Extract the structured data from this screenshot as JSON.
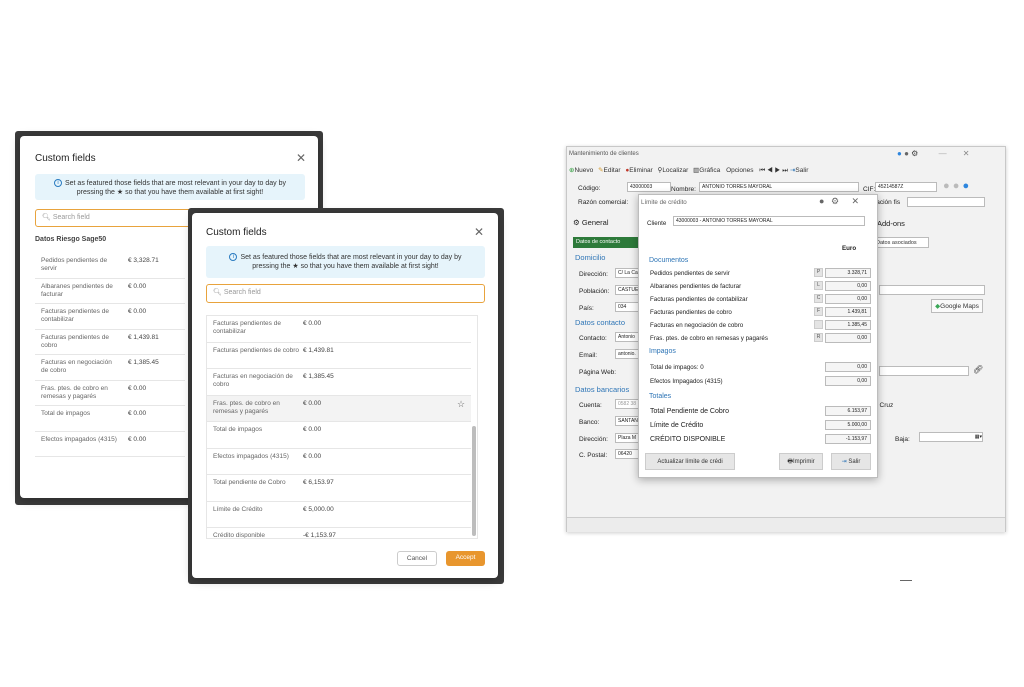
{
  "dialog_back": {
    "title": "Custom fields",
    "info": "Set as featured those fields that are most relevant in your day to day by pressing the ★ so that you have them available at first sight!",
    "search_placeholder": "Search field",
    "section_title": "Datos Riesgo Sage50",
    "rows": [
      {
        "label": "Pedidos pendientes de servir",
        "value": "€ 3,328.71"
      },
      {
        "label": "Albaranes pendientes de facturar",
        "value": "€ 0.00"
      },
      {
        "label": "Facturas pendientes de contabilizar",
        "value": "€ 0.00"
      },
      {
        "label": "Facturas pendientes de cobro",
        "value": "€ 1,439.81"
      },
      {
        "label": "Facturas en negociación de cobro",
        "value": "€ 1,385.45"
      },
      {
        "label": "Fras. ptes. de cobro en remesas y pagarés",
        "value": "€ 0.00"
      },
      {
        "label": "Total de impagos",
        "value": "€ 0.00"
      },
      {
        "label": "Efectos impagados (4315)",
        "value": "€ 0.00"
      }
    ]
  },
  "dialog_front": {
    "title": "Custom fields",
    "info": "Set as featured those fields that are most relevant in your day to day by pressing the ★ so that you have them available at first sight!",
    "search_placeholder": "Search field",
    "rows": [
      {
        "label": "Facturas pendientes de contabilizar",
        "value": "€ 0.00"
      },
      {
        "label": "Facturas pendientes de cobro",
        "value": "€ 1,439.81"
      },
      {
        "label": "Facturas en negociación de cobro",
        "value": "€ 1,385.45"
      },
      {
        "label": "Fras. ptes. de cobro en remesas y pagarés",
        "value": "€ 0.00"
      },
      {
        "label": "Total de impagos",
        "value": "€ 0.00"
      },
      {
        "label": "Efectos impagados (4315)",
        "value": "€ 0.00"
      },
      {
        "label": "Total pendiente de Cobro",
        "value": "€ 6,153.97"
      },
      {
        "label": "Límite de Crédito",
        "value": "€ 5,000.00"
      },
      {
        "label": "Crédito disponible",
        "value": "-€ 1,153.97"
      }
    ],
    "cancel_label": "Cancel",
    "accept_label": "Accept"
  },
  "sage": {
    "window_title": "Mantenimiento de clientes",
    "toolbar": [
      "Nuevo",
      "Editar",
      "Eliminar",
      "Localizar",
      "Gráfica",
      "Opciones",
      "Salir"
    ],
    "codigo_label": "Código:",
    "codigo_value": "43000003",
    "nombre_label": "Nombre:",
    "nombre_value": "ANTONIO TORRES MAYORAL",
    "cif_label": "CIF:",
    "cif_value": "45214587Z",
    "razon_label": "Razón comercial:",
    "tabs": [
      "General",
      "Add-ons"
    ],
    "subtabs": [
      "Datos de contacto",
      "Datos asociados"
    ],
    "domicilio": "Domicilio",
    "direccion_label": "Dirección:",
    "direccion_value": "C/ La Ca",
    "poblacion_label": "Población:",
    "poblacion_value": "CASTUE",
    "pais_label": "País:",
    "pais_value": "034",
    "google_maps": "Google Maps",
    "datos_contacto": "Datos contacto",
    "contacto_label": "Contacto:",
    "contacto_value": "Antonio",
    "email_label": "Email:",
    "email_value": "antonio.",
    "web_label": "Página Web:",
    "datos_bancarios": "Datos bancarios",
    "cuenta_label": "Cuenta:",
    "cuenta_value": "0582 38",
    "banco_label": "Banco:",
    "banco_value": "SANTAN",
    "direccion2_label": "Dirección:",
    "direccion2_value": "Plaza M",
    "cpostal_label": "C. Postal:",
    "cpostal_value": "06420",
    "right_cruz": "vi Cruz",
    "baja_label": "Baja:",
    "facturacion_label": "cación fis"
  },
  "limit": {
    "title": "Límite de crédito",
    "cliente_label": "Cliente",
    "cliente_value": "43000003 - ANTONIO TORRES MAYORAL",
    "euro_header": "Euro",
    "documentos": "Documentos",
    "doc_rows": [
      {
        "label": "Pedidos pendientes de servir",
        "letter": "P",
        "value": "3.328,71"
      },
      {
        "label": "Albaranes pendientes de facturar",
        "letter": "L",
        "value": "0,00"
      },
      {
        "label": "Facturas pendientes de contabilizar",
        "letter": "C",
        "value": "0,00"
      },
      {
        "label": "Facturas pendientes de cobro",
        "letter": "F",
        "value": "1.439,81"
      },
      {
        "label": "Facturas en negociación de cobro",
        "letter": "",
        "value": "1.385,45"
      },
      {
        "label": "Fras. ptes. de cobro en remesas y pagarés",
        "letter": "R",
        "value": "0,00"
      }
    ],
    "impagos": "Impagos",
    "imp_rows": [
      {
        "label": "Total de impagos: 0",
        "value": "0,00"
      },
      {
        "label": "Efectos Impagados (4315)",
        "value": "0,00"
      }
    ],
    "totales": "Totales",
    "tot_rows": [
      {
        "label": "Total Pendiente de Cobro",
        "value": "6.153,97"
      },
      {
        "label": "Límite de Crédito",
        "value": "5.000,00"
      },
      {
        "label": "CRÉDITO DISPONIBLE",
        "value": "-1.153,97"
      }
    ],
    "actualizar_label": "Actualizar límite de crédi",
    "imprimir_label": "Imprimir",
    "salir_label": "Salir"
  }
}
